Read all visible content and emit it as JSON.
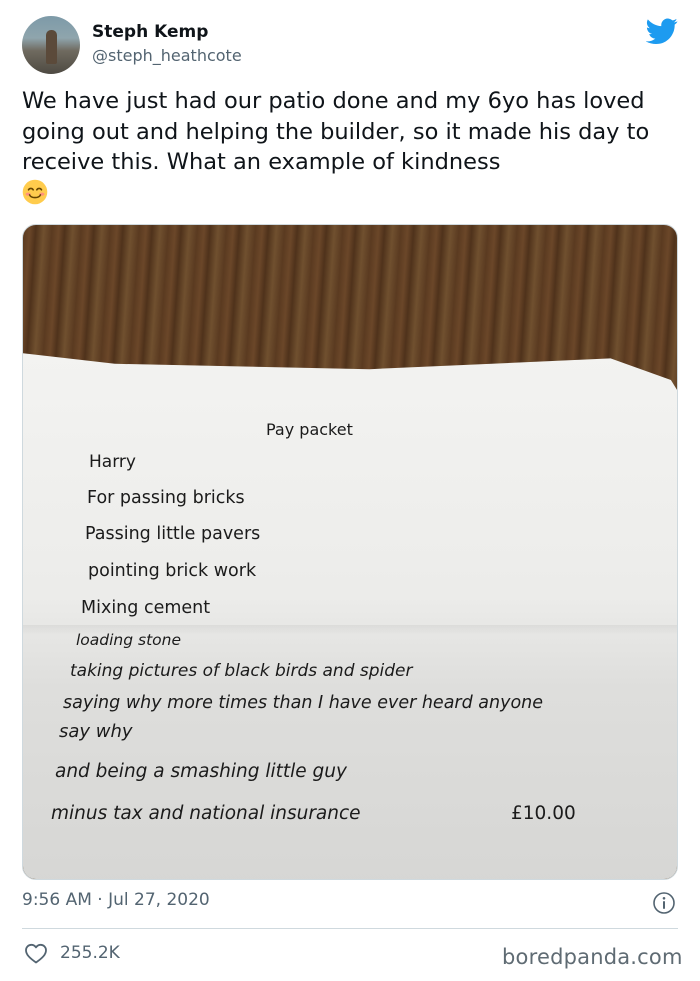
{
  "tweet": {
    "author_name": "Steph Kemp",
    "author_handle": "@steph_heathcote",
    "text": "We have just had our patio done and my 6yo has loved going out and helping the builder, so it made his day to receive this. What an example of kindness",
    "emoji": "smiling-face-emoji",
    "timestamp": "9:56 AM · Jul 27, 2020",
    "likes": "255.2K",
    "brand_color": "#1d9bf0"
  },
  "note": {
    "title": "Pay packet",
    "lines": [
      "Harry",
      "For passing bricks",
      "Passing little pavers",
      "pointing brick work",
      "Mixing cement",
      "loading stone",
      "taking pictures of black birds and spider",
      "saying why more times than I have ever heard anyone",
      "say why",
      "and being a smashing little guy",
      "minus tax and national insurance"
    ],
    "amount": "£10.00"
  },
  "watermark": "boredpanda.com"
}
